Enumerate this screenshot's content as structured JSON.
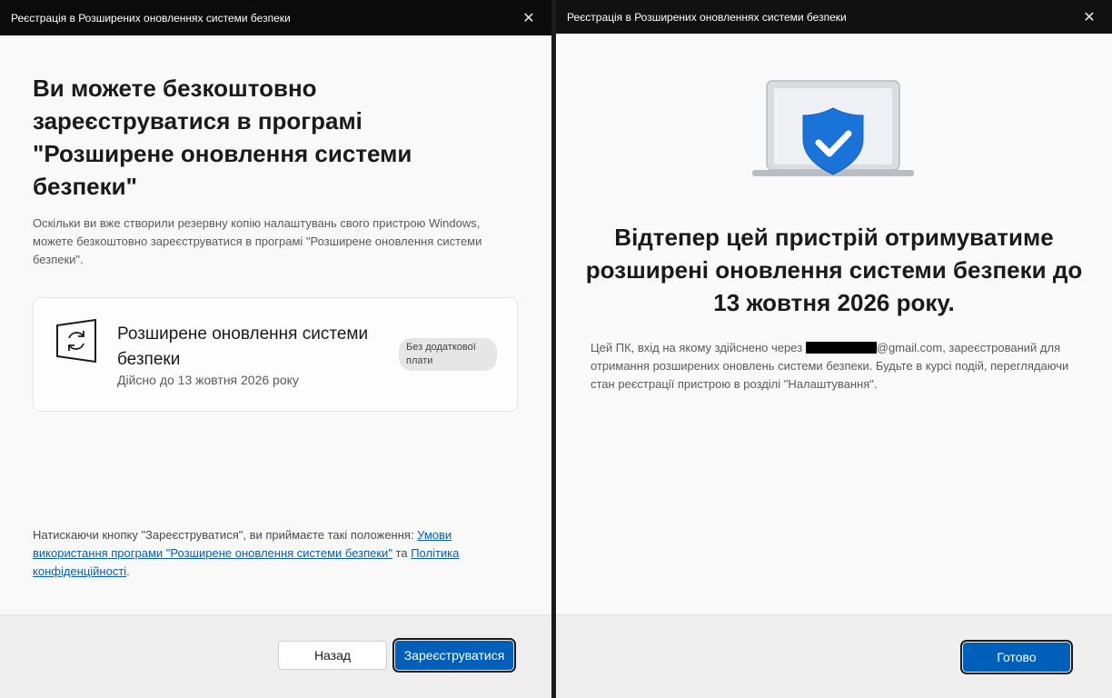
{
  "left_window": {
    "title": "Реєстрація в Розширених оновленнях системи безпеки",
    "heading": "Ви можете безкоштовно зареєструватися в програмі \"Розширене оновлення системи безпеки\"",
    "description": "Оскільки ви вже створили резервну копію налаштувань свого пристрою Windows, можете безкоштовно зареєструватися в програмі \"Розширене оновлення системи безпеки\".",
    "card": {
      "icon": "sync-window-icon",
      "title": "Розширене оновлення системи безпеки",
      "subtitle": "Дійсно до 13 жовтня 2026 року",
      "badge": "Без додаткової плати"
    },
    "terms": {
      "prefix": "Натискаючи кнопку \"Зареєструватися\", ви приймаєте такі положення: ",
      "link1": "Умови використання програми \"Розширене оновлення системи безпеки\"",
      "middle": " та ",
      "link2": "Політика конфіденційності",
      "suffix": "."
    },
    "buttons": {
      "back": "Назад",
      "register": "Зареєструватися"
    }
  },
  "right_window": {
    "title": "Реєстрація в Розширених оновленнях системи безпеки",
    "hero_icon": "laptop-shield-check-icon",
    "heading": "Відтепер цей пристрій отримуватиме розширені оновлення системи безпеки до 13 жовтня 2026 року.",
    "desc_prefix": "Цей ПК, вхід на якому здійснено через ",
    "email_suffix": "@gmail.com",
    "desc_suffix": ", зареєстрований для отримання розширених оновлень системи безпеки. Будьте в курсі подій, переглядаючи стан реєстрації пристрою в розділі \"Налаштування\".",
    "buttons": {
      "done": "Готово"
    }
  },
  "colors": {
    "accent": "#005fb8",
    "link": "#0a5fb4",
    "shield": "#1a73d9"
  }
}
